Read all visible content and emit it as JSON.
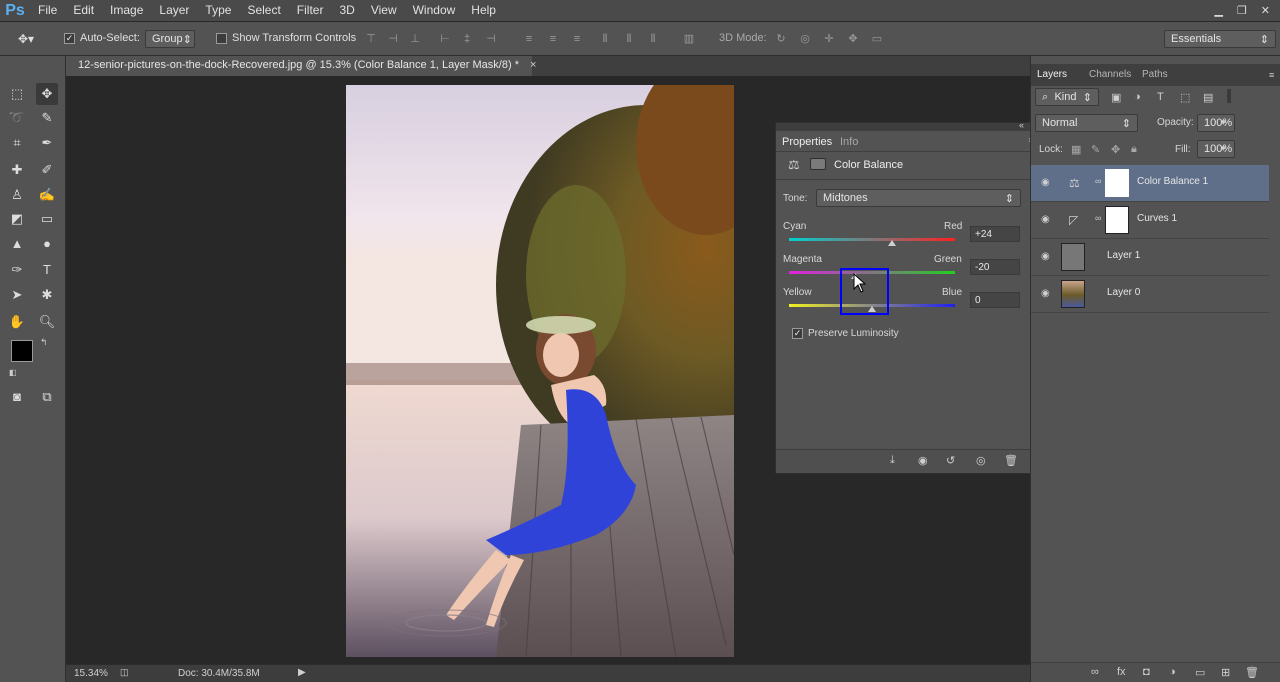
{
  "app": {
    "logo": "Ps"
  },
  "menu": [
    "File",
    "Edit",
    "Image",
    "Layer",
    "Type",
    "Select",
    "Filter",
    "3D",
    "View",
    "Window",
    "Help"
  ],
  "window_controls": {
    "minimize": "▁",
    "restore": "❐",
    "close": "✕"
  },
  "options_bar": {
    "auto_select_label": "Auto-Select:",
    "auto_select_checked": true,
    "auto_select_value": "Group",
    "show_transform_label": "Show Transform Controls",
    "mode_3d_label": "3D Mode:",
    "workspace": "Essentials"
  },
  "document": {
    "tab_title": "12-senior-pictures-on-the-dock-Recovered.jpg @ 15.3% (Color Balance 1, Layer Mask/8) *",
    "tab_close": "×",
    "zoom": "15.34%",
    "doc_size": "Doc: 30.4M/35.8M"
  },
  "properties": {
    "tabs": [
      "Properties",
      "Info"
    ],
    "title": "Color Balance",
    "tone_label": "Tone:",
    "tone_value": "Midtones",
    "sliders": [
      {
        "left": "Cyan",
        "right": "Red",
        "value": "+24",
        "fraction": 0.62
      },
      {
        "left": "Magenta",
        "right": "Green",
        "value": "-20",
        "fraction": 0.4
      },
      {
        "left": "Yellow",
        "right": "Blue",
        "value": "0",
        "fraction": 0.5
      }
    ],
    "preserve_luminosity_label": "Preserve Luminosity",
    "preserve_luminosity_checked": true
  },
  "layers_panel": {
    "tabs": [
      "Layers",
      "Channels",
      "Paths"
    ],
    "kind_label": "Kind",
    "blend_mode": "Normal",
    "opacity_label": "Opacity:",
    "opacity": "100%",
    "fill_label": "Fill:",
    "fill": "100%",
    "lock_label": "Lock:",
    "layers": [
      {
        "name": "Color Balance 1",
        "selected": true
      },
      {
        "name": "Curves 1",
        "selected": false
      },
      {
        "name": "Layer 1",
        "selected": false
      },
      {
        "name": "Layer 0",
        "selected": false
      }
    ]
  },
  "colors": {
    "highlight": "#0000ff",
    "selection": "#5f6f8a"
  }
}
